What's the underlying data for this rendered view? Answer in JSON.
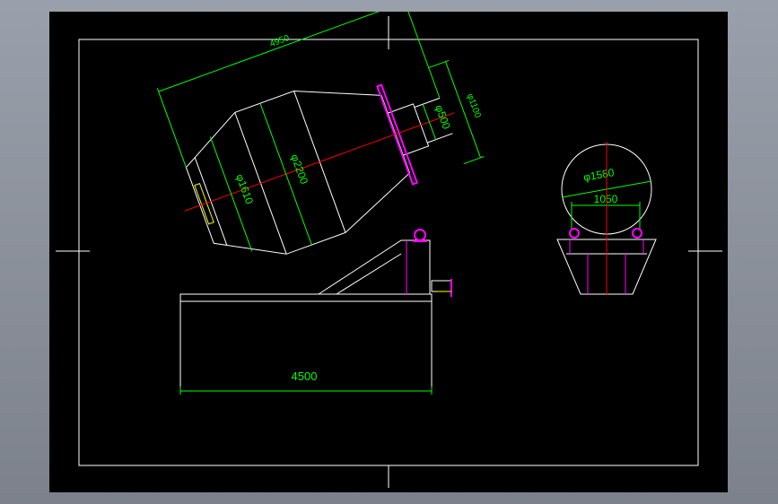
{
  "colors": {
    "background": "#000000",
    "outline": "#ffffff",
    "dimension": "#00ff00",
    "centerline": "#ff0000",
    "support": "#ff00ff",
    "accent": "#ffff00",
    "frame_window": "#8a8e99"
  },
  "dimensions": {
    "drum_length": "4950",
    "drum_diameter": "φ2200",
    "opening_diameter": "φ1610",
    "neck_diameter": "φ500",
    "shaft_diameter": "φ1100",
    "base_length": "4500",
    "end_circle_diameter": "φ1580",
    "end_base_width": "1050"
  }
}
